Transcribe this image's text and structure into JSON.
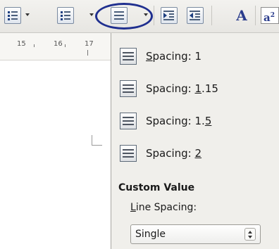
{
  "toolbar": {
    "superscript_label": "a",
    "superscript_sup": "2",
    "font_color_glyph": "A"
  },
  "ruler": {
    "labels": [
      "15",
      "16",
      "17"
    ]
  },
  "menu": {
    "items": [
      {
        "pre": "",
        "key": "S",
        "post": "pacing: 1"
      },
      {
        "pre": "Spacing: ",
        "key": "1",
        "post": ".15"
      },
      {
        "pre": "Spacing: 1.",
        "key": "5",
        "post": ""
      },
      {
        "pre": "Spacing: ",
        "key": "2",
        "post": ""
      }
    ],
    "custom_title": "Custom Value",
    "line_spacing_key": "L",
    "line_spacing_rest": "ine Spacing:",
    "select_value": "Single"
  },
  "colors": {
    "highlight_circle": "#1f2f8f",
    "panel_bg": "#f0efeb",
    "icon_blue": "#2a3c8c"
  }
}
